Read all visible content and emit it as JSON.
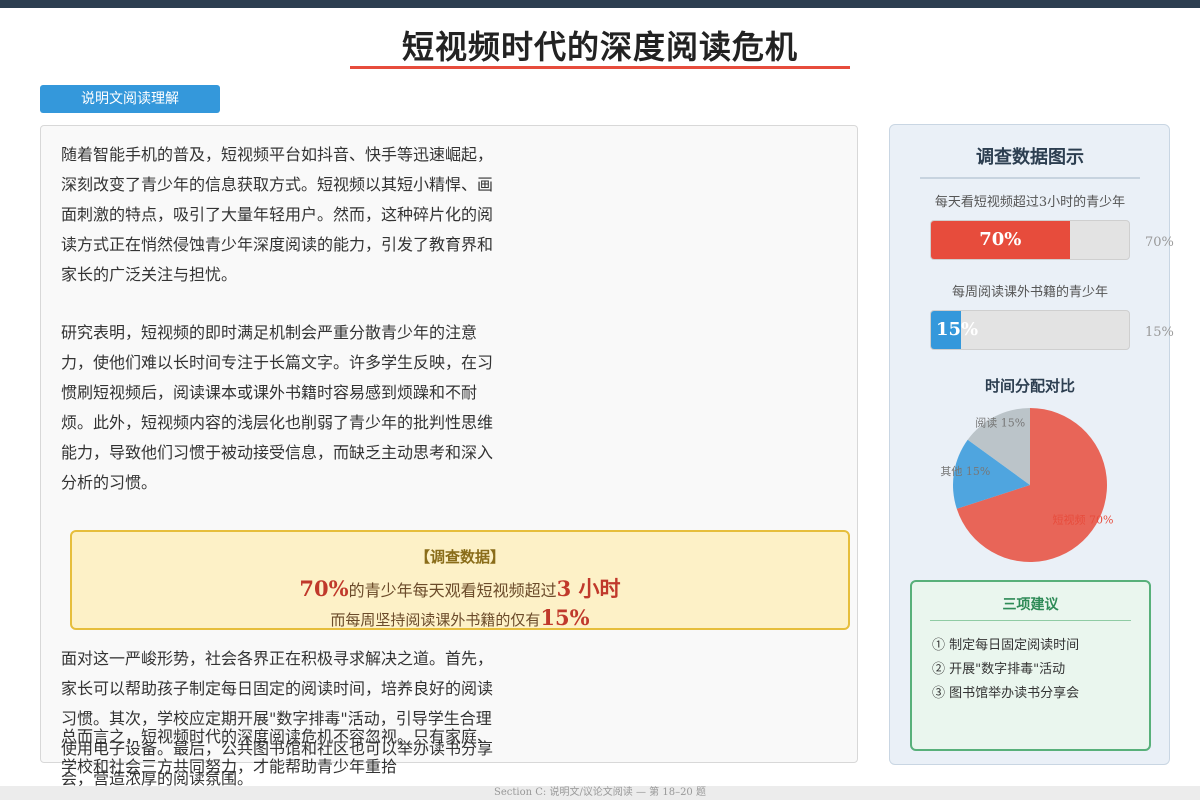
{
  "page": {
    "title": "短视频时代的深度阅读危机",
    "tag": "说明文阅读理解",
    "footer": "Section C: 说明文/议论文阅读 — 第 18–20 题"
  },
  "article": {
    "p1": "随着智能手机的普及，短视频平台如抖音、快手等迅速崛起，深刻改变了青少年的信息获取方式。短视频以其短小精悍、画面刺激的特点，吸引了大量年轻用户。然而，这种碎片化的阅读方式正在悄然侵蚀青少年深度阅读的能力，引发了教育界和家长的广泛关注与担忧。",
    "p2": "研究表明，短视频的即时满足机制会严重分散青少年的注意力，使他们难以长时间专注于长篇文字。许多学生反映，在习惯刷短视频后，阅读课本或课外书籍时容易感到烦躁和不耐烦。此外，短视频内容的浅层化也削弱了青少年的批判性思维能力，导致他们习惯于被动接受信息，而缺乏主动思考和深入分析的习惯。",
    "p3": "面对这一严峻形势，社会各界正在积极寻求解决之道。首先，家长可以帮助孩子制定每日固定的阅读时间，培养良好的阅读习惯。其次，学校应定期开展\"数字排毒\"活动，引导学生合理使用电子设备。最后，公共图书馆和社区也可以举办读书分享会，营造浓厚的阅读氛围。",
    "p4": "总而言之，短视频时代的深度阅读危机不容忽视。只有家庭、学校和社会三方共同努力，才能帮助青少年重拾"
  },
  "callout": {
    "head": "【调查数据】",
    "n1": "70%",
    "t1": "的青少年每天观看短视频超过",
    "n2": "3 小时",
    "t2": "而每周坚持阅读课外书籍的仅有",
    "n3": "15%"
  },
  "sidebar": {
    "title": "调查数据图示",
    "bar1": {
      "label": "每天看短视频超过3小时的青少年",
      "value_text": "70%",
      "value": 70,
      "color": "#e74c3c"
    },
    "bar2": {
      "label": "每周阅读课外书籍的青少年",
      "value_text": "15%",
      "value": 15,
      "color": "#3498db"
    },
    "pie_title": "时间分配对比"
  },
  "chart_data": {
    "type": "pie",
    "title": "时间分配对比",
    "slices": [
      {
        "label": "短视频 70%",
        "value": 70,
        "color": "#e74c3c"
      },
      {
        "label": "其他 15%",
        "value": 15,
        "color": "#3498db"
      },
      {
        "label": "阅读 15%",
        "value": 15,
        "color": "#b3bcc1"
      }
    ]
  },
  "tips": {
    "title": "三项建议",
    "items": [
      "① 制定每日固定阅读时间",
      "② 开展\"数字排毒\"活动",
      "③ 图书馆举办读书分享会"
    ]
  }
}
